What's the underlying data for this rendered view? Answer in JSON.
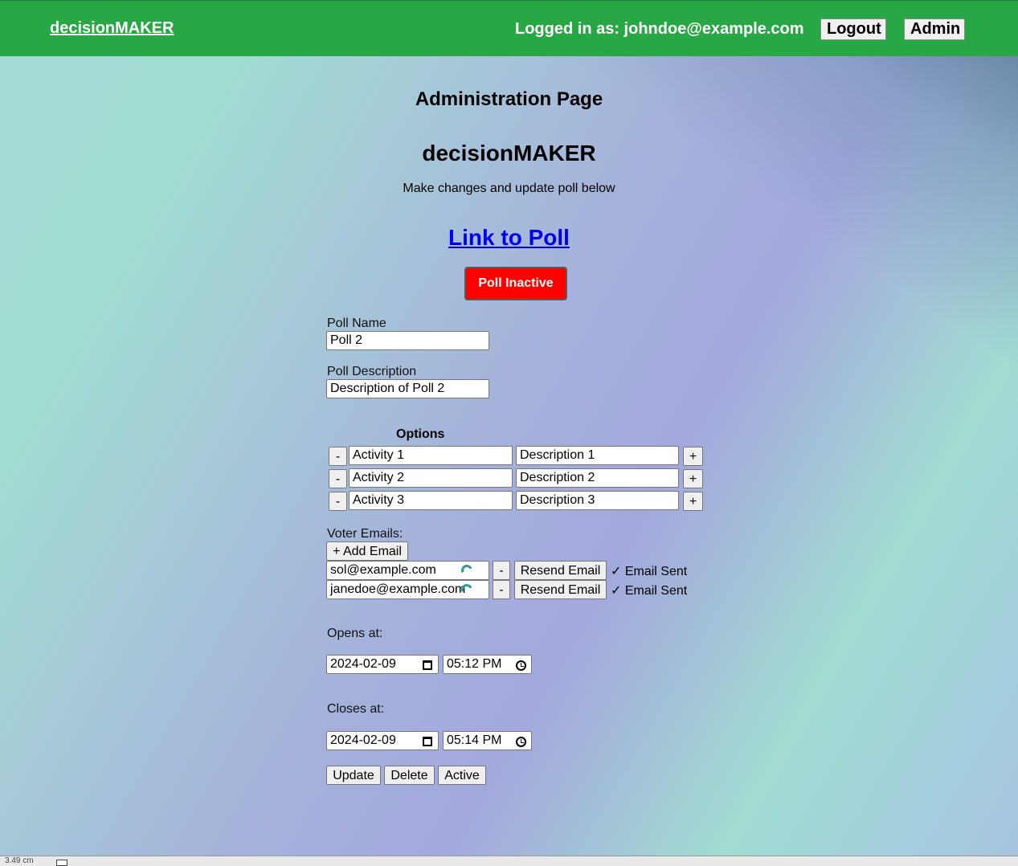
{
  "nav": {
    "brand": "decisionMAKER",
    "logged_in": "Logged in as: johndoe@example.com",
    "logout": "Logout",
    "admin": "Admin"
  },
  "page": {
    "admin_title": "Administration Page",
    "app_title": "decisionMAKER",
    "subtitle": "Make changes and update poll below",
    "poll_link": "Link to Poll",
    "status_button": "Poll Inactive",
    "status_color": "#ff0000"
  },
  "form": {
    "poll_name_label": "Poll Name",
    "poll_name_value": "Poll 2",
    "poll_desc_label": "Poll Description",
    "poll_desc_value": "Description of Poll 2",
    "options_title": "Options",
    "remove_label": "-",
    "add_label": "+",
    "options": [
      {
        "name": "Activity 1",
        "description": "Description 1"
      },
      {
        "name": "Activity 2",
        "description": "Description 2"
      },
      {
        "name": "Activity 3",
        "description": "Description 3"
      }
    ],
    "voter_emails_label": "Voter Emails:",
    "add_email": "+ Add Email",
    "resend_label": "Resend Email",
    "emails": [
      {
        "email": "sol@example.com",
        "status": "✓ Email Sent"
      },
      {
        "email": "janedoe@example.com",
        "status": "✓ Email Sent"
      }
    ],
    "opens_label": "Opens at:",
    "opens_date": "2024-02-09",
    "opens_time": "05:12 PM",
    "closes_label": "Closes at:",
    "closes_date": "2024-02-09",
    "closes_time": "05:14 PM",
    "update": "Update",
    "delete": "Delete",
    "active": "Active"
  },
  "statusbar": {
    "text": "3.49 cm"
  },
  "colors": {
    "navbar": "#28a745",
    "link": "#0000ee"
  }
}
